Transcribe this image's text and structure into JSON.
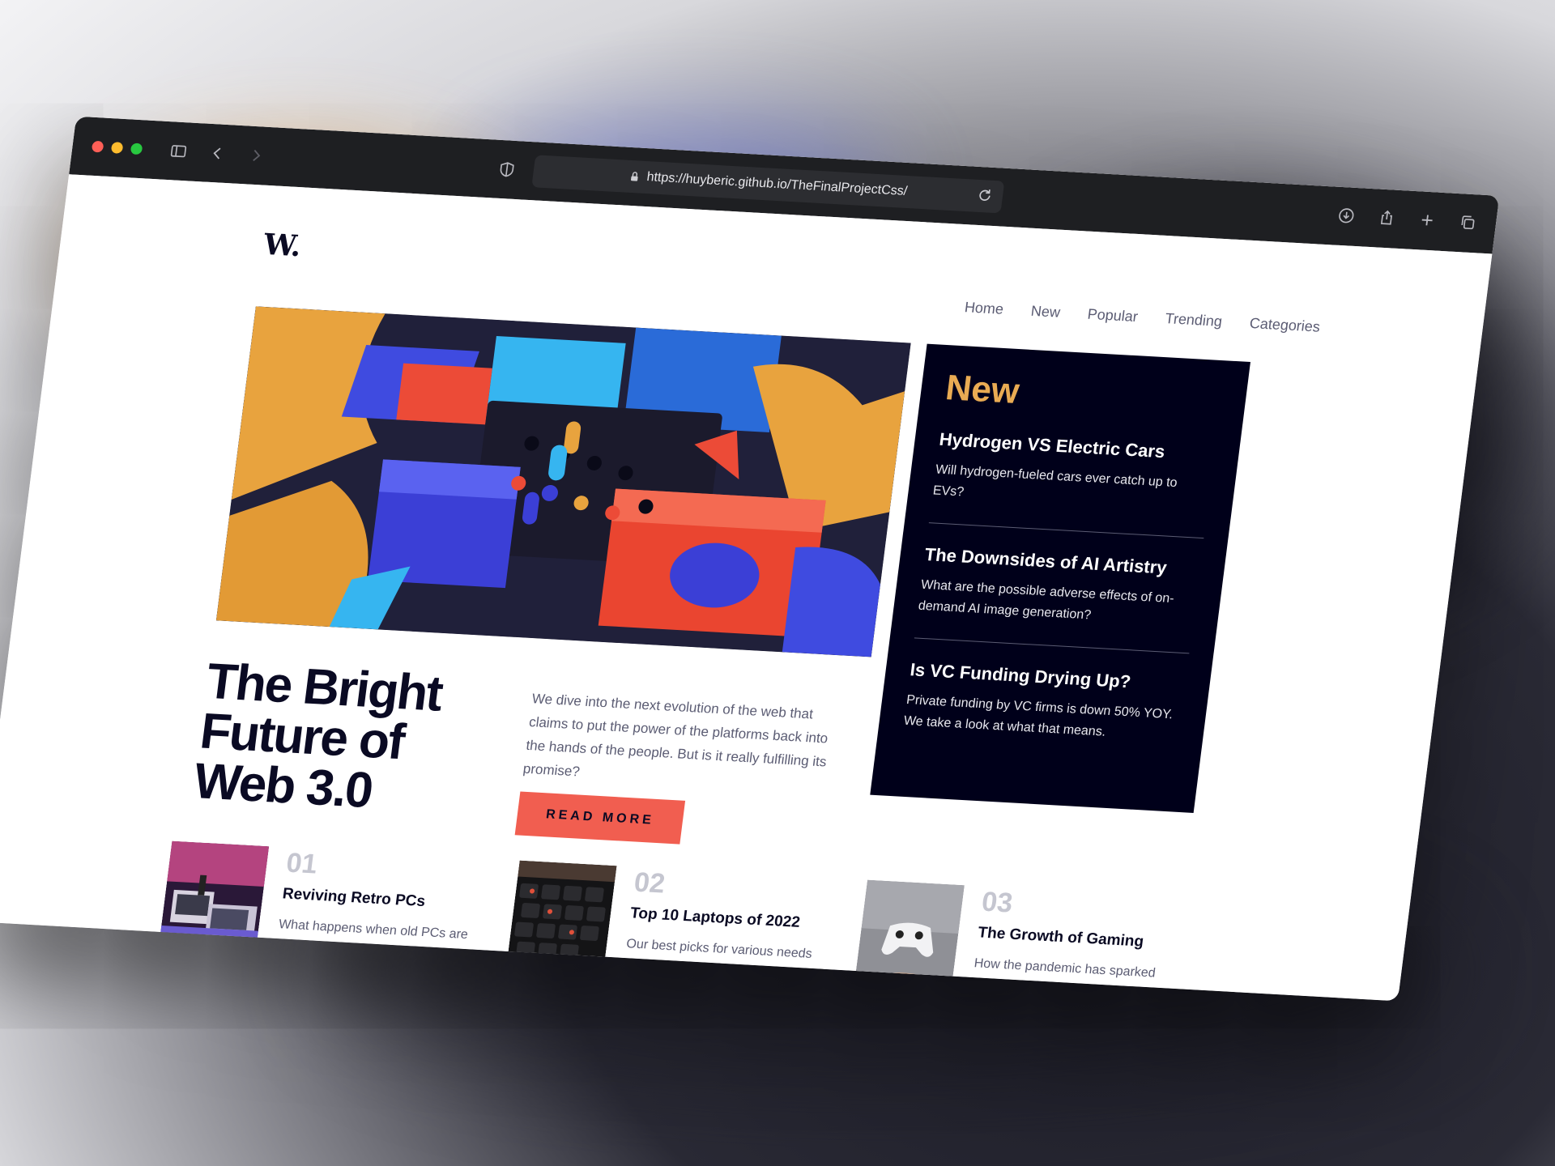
{
  "browser": {
    "url": "https://huyberic.github.io/TheFinalProjectCss/"
  },
  "site": {
    "logo": "W.",
    "nav": [
      "Home",
      "New",
      "Popular",
      "Trending",
      "Categories"
    ]
  },
  "hero": {
    "title": "The Bright Future of Web 3.0",
    "description": "We dive into the next evolution of the web that claims to put the power of the platforms back into the hands of the people. But is it really fulfilling its promise?",
    "button_label": "READ MORE"
  },
  "new_panel": {
    "heading": "New",
    "items": [
      {
        "title": "Hydrogen VS Electric Cars",
        "text": "Will hydrogen-fueled cars ever catch up to EVs?"
      },
      {
        "title": "The Downsides of AI Artistry",
        "text": "What are the possible adverse effects of on-demand AI image generation?"
      },
      {
        "title": "Is VC Funding Drying Up?",
        "text": "Private funding by VC firms is down 50% YOY. We take a look at what that means."
      }
    ]
  },
  "articles": [
    {
      "number": "01",
      "title": "Reviving Retro PCs",
      "text": "What happens when old PCs are given modern upgrades?"
    },
    {
      "number": "02",
      "title": "Top 10 Laptops of 2022",
      "text": "Our best picks for various needs and budgets."
    },
    {
      "number": "03",
      "title": "The Growth of Gaming",
      "text": "How the pandemic has sparked fresh opportunities."
    }
  ],
  "colors": {
    "accent_orange": "#e9ab53",
    "button_red": "#f15e50",
    "dark_navy": "#00001a",
    "muted_text": "#5b5c73"
  }
}
